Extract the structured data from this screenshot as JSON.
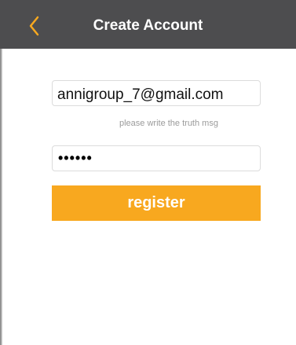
{
  "navbar": {
    "title": "Create Account",
    "back_icon": "chevron-left-icon",
    "accent_color": "#f8a81f"
  },
  "form": {
    "email_value": "annigroup_7@gmail.com",
    "hint": "please write the truth msg",
    "password_value": "••••••",
    "register_label": "register"
  }
}
